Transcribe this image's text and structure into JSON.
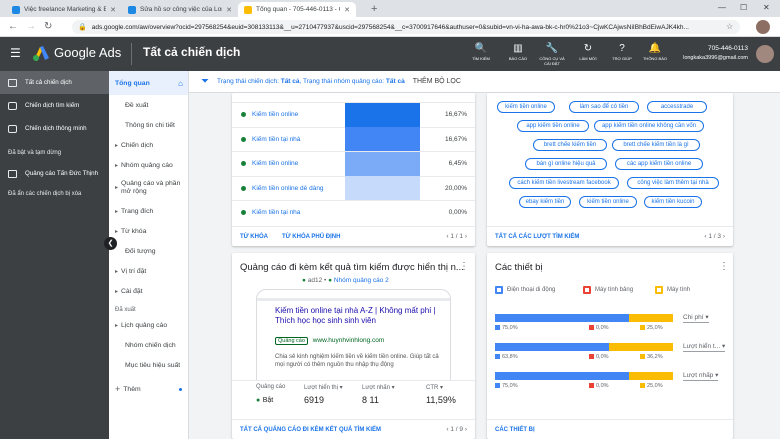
{
  "browser": {
    "tabs": [
      {
        "title": "Việc freelance Marketing & Bán h",
        "active": false,
        "favicon_color": "#1e88e5"
      },
      {
        "title": "Sửa hồ sơ công việc của Long Hu",
        "active": false,
        "favicon_color": "#1e88e5"
      },
      {
        "title": "Tổng quan - 705-446-0113 - Goo",
        "active": true,
        "favicon_color": "#fbbc04"
      }
    ],
    "url": "ads.google.com/aw/overview?ocid=297568254&euid=308133113&__u=2710477937&uscid=297568254&__c=3700917646&authuser=0&subid=vn-vi-ha-awa-bk-c-hr0%21o3~CjwKCAjwsNiIBhBdEiwAJK4kh..."
  },
  "header": {
    "brand": "Google Ads",
    "page_title": "Tất cả chiến dịch",
    "buttons": [
      {
        "label": "TÌM KIẾM",
        "icon": "search-icon",
        "glyph": "🔍"
      },
      {
        "label": "BÁO CÁO",
        "icon": "reports-icon",
        "glyph": "▥"
      },
      {
        "label": "CÔNG CỤ VÀ CÀI ĐẶT",
        "icon": "wrench-icon",
        "glyph": "🔧"
      },
      {
        "label": "LÀM MỚI",
        "icon": "refresh-icon",
        "glyph": "↻"
      },
      {
        "label": "TRỢ GIÚP",
        "icon": "help-icon",
        "glyph": "?"
      },
      {
        "label": "THÔNG BÁO",
        "icon": "bell-icon",
        "glyph": "🔔"
      }
    ],
    "account_id": "705-446-0113",
    "email": "longkaka3996@gmail.com"
  },
  "left_nav": {
    "campaigns": [
      {
        "label": "Tất cả chiến dịch",
        "icon": "campaigns-icon",
        "selected": true
      },
      {
        "label": "Chiến dịch tìm kiếm",
        "icon": "search-campaign-icon",
        "selected": false
      },
      {
        "label": "Chiến dịch thông minh",
        "icon": "smart-campaign-icon",
        "selected": false
      }
    ],
    "enabled_paused": "Đã bật và tạm dừng",
    "shop_campaign": "Quảng cáo Tấn Đức Thịnh",
    "hidden_removed": "Đã ẩn các chiến dịch bị xóa"
  },
  "sub_nav": {
    "items": [
      {
        "label": "Tổng quan",
        "kind": "selected"
      },
      {
        "label": "Đề xuất",
        "kind": "indent"
      },
      {
        "label": "Thông tin chi tiết",
        "kind": "indent"
      },
      {
        "label": "Chiến dịch",
        "kind": "caret"
      },
      {
        "label": "Nhóm quảng cáo",
        "kind": "caret"
      },
      {
        "label": "Quảng cáo và phần mở rộng",
        "kind": "caret2"
      },
      {
        "label": "Trang đích",
        "kind": "caret"
      },
      {
        "label": "Từ khóa",
        "kind": "caret"
      },
      {
        "label": "Đối tượng",
        "kind": "indent"
      },
      {
        "label": "Vị trí đặt",
        "kind": "caret"
      },
      {
        "label": "Cài đặt",
        "kind": "caret"
      }
    ],
    "section2_label": "Đã xuất",
    "items2": [
      {
        "label": "Lịch quảng cáo",
        "kind": "caret"
      },
      {
        "label": "Nhóm chiến dịch",
        "kind": "indent"
      },
      {
        "label": "Mục tiêu hiệu suất",
        "kind": "indent"
      }
    ],
    "more_label": "Thêm"
  },
  "filter_bar": {
    "campaign_status_label": "Trạng thái chiến dịch:",
    "campaign_status_value": "Tất cả",
    "adgroup_status_label": "Trạng thái nhóm quảng cáo:",
    "adgroup_status_value": "Tất cả",
    "add_filter": "THÊM BỘ LỌC"
  },
  "keywords_card": {
    "rows": [
      {
        "keyword": "Kiếm tiền online",
        "pct": "16,67%",
        "heat": "#1a73e8"
      },
      {
        "keyword": "Kiếm tiền tại nhà",
        "pct": "16,67%",
        "heat": "#4285f4"
      },
      {
        "keyword": "Kiếm tiền online",
        "pct": "6,45%",
        "heat": "#7baaf7"
      },
      {
        "keyword": "Kiếm tiền online dễ dàng",
        "pct": "20,00%",
        "heat": "#c6dafc"
      },
      {
        "keyword": "Kiếm tiền tại nha",
        "pct": "0,00%",
        "heat": "#ffffff"
      }
    ],
    "footer_links": [
      "TỪ KHÓA",
      "TỪ KHÓA PHỦ ĐỊNH"
    ],
    "pager": "1 / 1"
  },
  "search_terms_card": {
    "chips": [
      "kiếm tiền online",
      "làm sao để có tiền",
      "accesstrade",
      "app kiếm tiền online",
      "app kiếm tiền online không cần vốn",
      "brett chếe kiếm tiền",
      "brett chếe kiếm tiền là gì",
      "bán gì online hiệu quả",
      "các app kiếm tiền online",
      "cách kiếm tiền livestream facebook",
      "công việc làm thêm tại nhà",
      "ebay kiếm tiền",
      "kiếm tiền online",
      "kiếm tiền kucoin"
    ],
    "footer_link": "TẤT CẢ CÁC LƯỢT TÌM KIẾM",
    "pager": "1 / 3"
  },
  "ad_card": {
    "title": "Quảng cáo đi kèm kết quả tìm kiếm được hiển thị n...",
    "ad_name": "ad12",
    "ad_group": "Nhóm quảng cáo 2",
    "headline": "Kiếm tiền online tại nhà A-Z | Không mất phí | Thích học học sinh sinh viên",
    "badge": "Quảng cáo",
    "display_url": "www.huynhvinhlong.com",
    "description": "Chia sẻ kinh nghiệm kiếm tiền về kiếm tiền online. Giúp tất cả mọi người có thêm nguồn thu nhập thụ động",
    "stats": [
      {
        "label": "Quảng cáo",
        "value": "Bật",
        "dropdown": false
      },
      {
        "label": "Lượt hiển thị",
        "value": "6919",
        "dropdown": true
      },
      {
        "label": "Lượt nhấn",
        "value": "8 11",
        "dropdown": true
      },
      {
        "label": "CTR",
        "value": "11,59%",
        "dropdown": true
      }
    ],
    "footer_link": "TẤT CẢ QUẢNG CÁO ĐI KÈM KẾT QUẢ TÌM KIẾM",
    "pager": "1 / 9"
  },
  "devices_card": {
    "title": "Các thiết bị",
    "legend": [
      {
        "label": "Điện thoại di động",
        "color": "#4285f4",
        "icon": "mobile-icon"
      },
      {
        "label": "Máy tính bảng",
        "color": "#ea4335",
        "icon": "tablet-icon"
      },
      {
        "label": "Máy tính",
        "color": "#fbbc04",
        "icon": "desktop-icon"
      }
    ],
    "metrics": [
      {
        "name": "Chi phí",
        "shares": [
          75.0,
          0.0,
          25.0
        ],
        "labels": [
          "75,0%",
          "0,0%",
          "25,0%"
        ]
      },
      {
        "name": "Lượt hiển t...",
        "shares": [
          63.8,
          0.0,
          36.2
        ],
        "labels": [
          "63,8%",
          "0,0%",
          "36,2%"
        ]
      },
      {
        "name": "Lượt nhấp",
        "shares": [
          75.0,
          0.0,
          25.0
        ],
        "labels": [
          "75,0%",
          "0,0%",
          "25,0%"
        ]
      }
    ],
    "footer_link": "CÁC THIẾT BỊ"
  }
}
